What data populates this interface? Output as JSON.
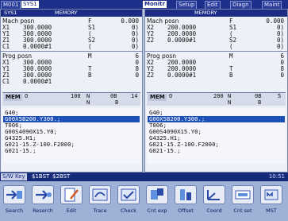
{
  "top_tabs": {
    "left": [
      "M001",
      "SYS1"
    ],
    "right": [
      "Monitr",
      "Setup",
      "Edit",
      "Diagn",
      "Maint"
    ]
  },
  "left_pane": {
    "sys_label": "SYS1",
    "mode": "MEMORY",
    "mach_posn": {
      "caption": "Mach posn",
      "rows": [
        {
          "axis": "X1",
          "value": "300.0000",
          "code": "F",
          "right": "0.000"
        },
        {
          "axis": "Y1",
          "value": "300.0000",
          "code": "S1",
          "right": "0)"
        },
        {
          "axis": "Z1",
          "value": "300.0000",
          "code": "(",
          "right": "0)"
        },
        {
          "axis": "C1",
          "value": "0.0000#1",
          "code": "S2",
          "right": "0)"
        },
        {
          "axis": "",
          "value": "",
          "code": "(",
          "right": "0)"
        }
      ]
    },
    "prog_posn": {
      "caption": "Prog posn",
      "rows": [
        {
          "axis": "X1",
          "value": "300.0000",
          "code": "M",
          "right": "6"
        },
        {
          "axis": "Y1",
          "value": "300.0000",
          "code": "",
          "right": "0"
        },
        {
          "axis": "Z1",
          "value": "300.0000",
          "code": "T",
          "right": "8"
        },
        {
          "axis": "C1",
          "value": "0.0000#1",
          "code": "B",
          "right": "0"
        }
      ]
    },
    "mem": {
      "label": "MEM",
      "o": "O",
      "o_val": "100",
      "n": "N",
      "n_val": "0B",
      "num": "14",
      "n2": "N",
      "b": "B"
    },
    "program": [
      "G40;",
      "G00X5B200.Y300.;",
      "T006;",
      "G00S4090X15.Y0;",
      "G4325.H1;",
      "G021-15.Z-100.F2000;",
      "G021-15.;"
    ]
  },
  "right_pane": {
    "mode": "MEMORY",
    "mach_posn": {
      "caption": "Mach posn",
      "rows": [
        {
          "axis": "X2",
          "value": "200.0000",
          "code": "F",
          "right": "0.000"
        },
        {
          "axis": "Y2",
          "value": "200.0000",
          "code": "S1",
          "right": "0)"
        },
        {
          "axis": "Z2",
          "value": "0.0000#1",
          "code": "(",
          "right": "0)"
        },
        {
          "axis": "",
          "value": "",
          "code": "S2",
          "right": "0)"
        },
        {
          "axis": "",
          "value": "",
          "code": "(",
          "right": "0)"
        }
      ]
    },
    "prog_posn": {
      "caption": "Prog posn",
      "rows": [
        {
          "axis": "X2",
          "value": "200.0000",
          "code": "M",
          "right": "6"
        },
        {
          "axis": "Y2",
          "value": "200.0000",
          "code": "",
          "right": "0"
        },
        {
          "axis": "Z2",
          "value": "0.0000#1",
          "code": "T",
          "right": "8"
        },
        {
          "axis": "",
          "value": "",
          "code": "B",
          "right": "0"
        }
      ]
    },
    "mem": {
      "label": "MEM",
      "o": "O",
      "o_val": "200",
      "n": "N",
      "n_val": "0B",
      "num": "5",
      "n2": "N",
      "b": "B"
    },
    "program": [
      "G40;",
      "G00X5B200.Y300.;",
      "T006;",
      "G00S4090X15.Y0;",
      "G4325.H1;",
      "G021-15.Z-100.F2000;",
      "G021-15.;"
    ]
  },
  "status_bar": {
    "swkey": "S/W Key",
    "sys1": "$1BST",
    "sys2": "$2BST",
    "clock": "10:51"
  },
  "softkeys": [
    "Search",
    "Reserch",
    "Edit",
    "Trace",
    "Check",
    "Cnt exp",
    "Offset",
    "Coord",
    "Cnt set",
    "MST"
  ],
  "icons": [
    "search-icon",
    "research-icon",
    "edit-icon",
    "trace-icon",
    "check-icon",
    "count-expand-icon",
    "offset-icon",
    "coordinate-icon",
    "count-set-icon",
    "mst-icon"
  ]
}
